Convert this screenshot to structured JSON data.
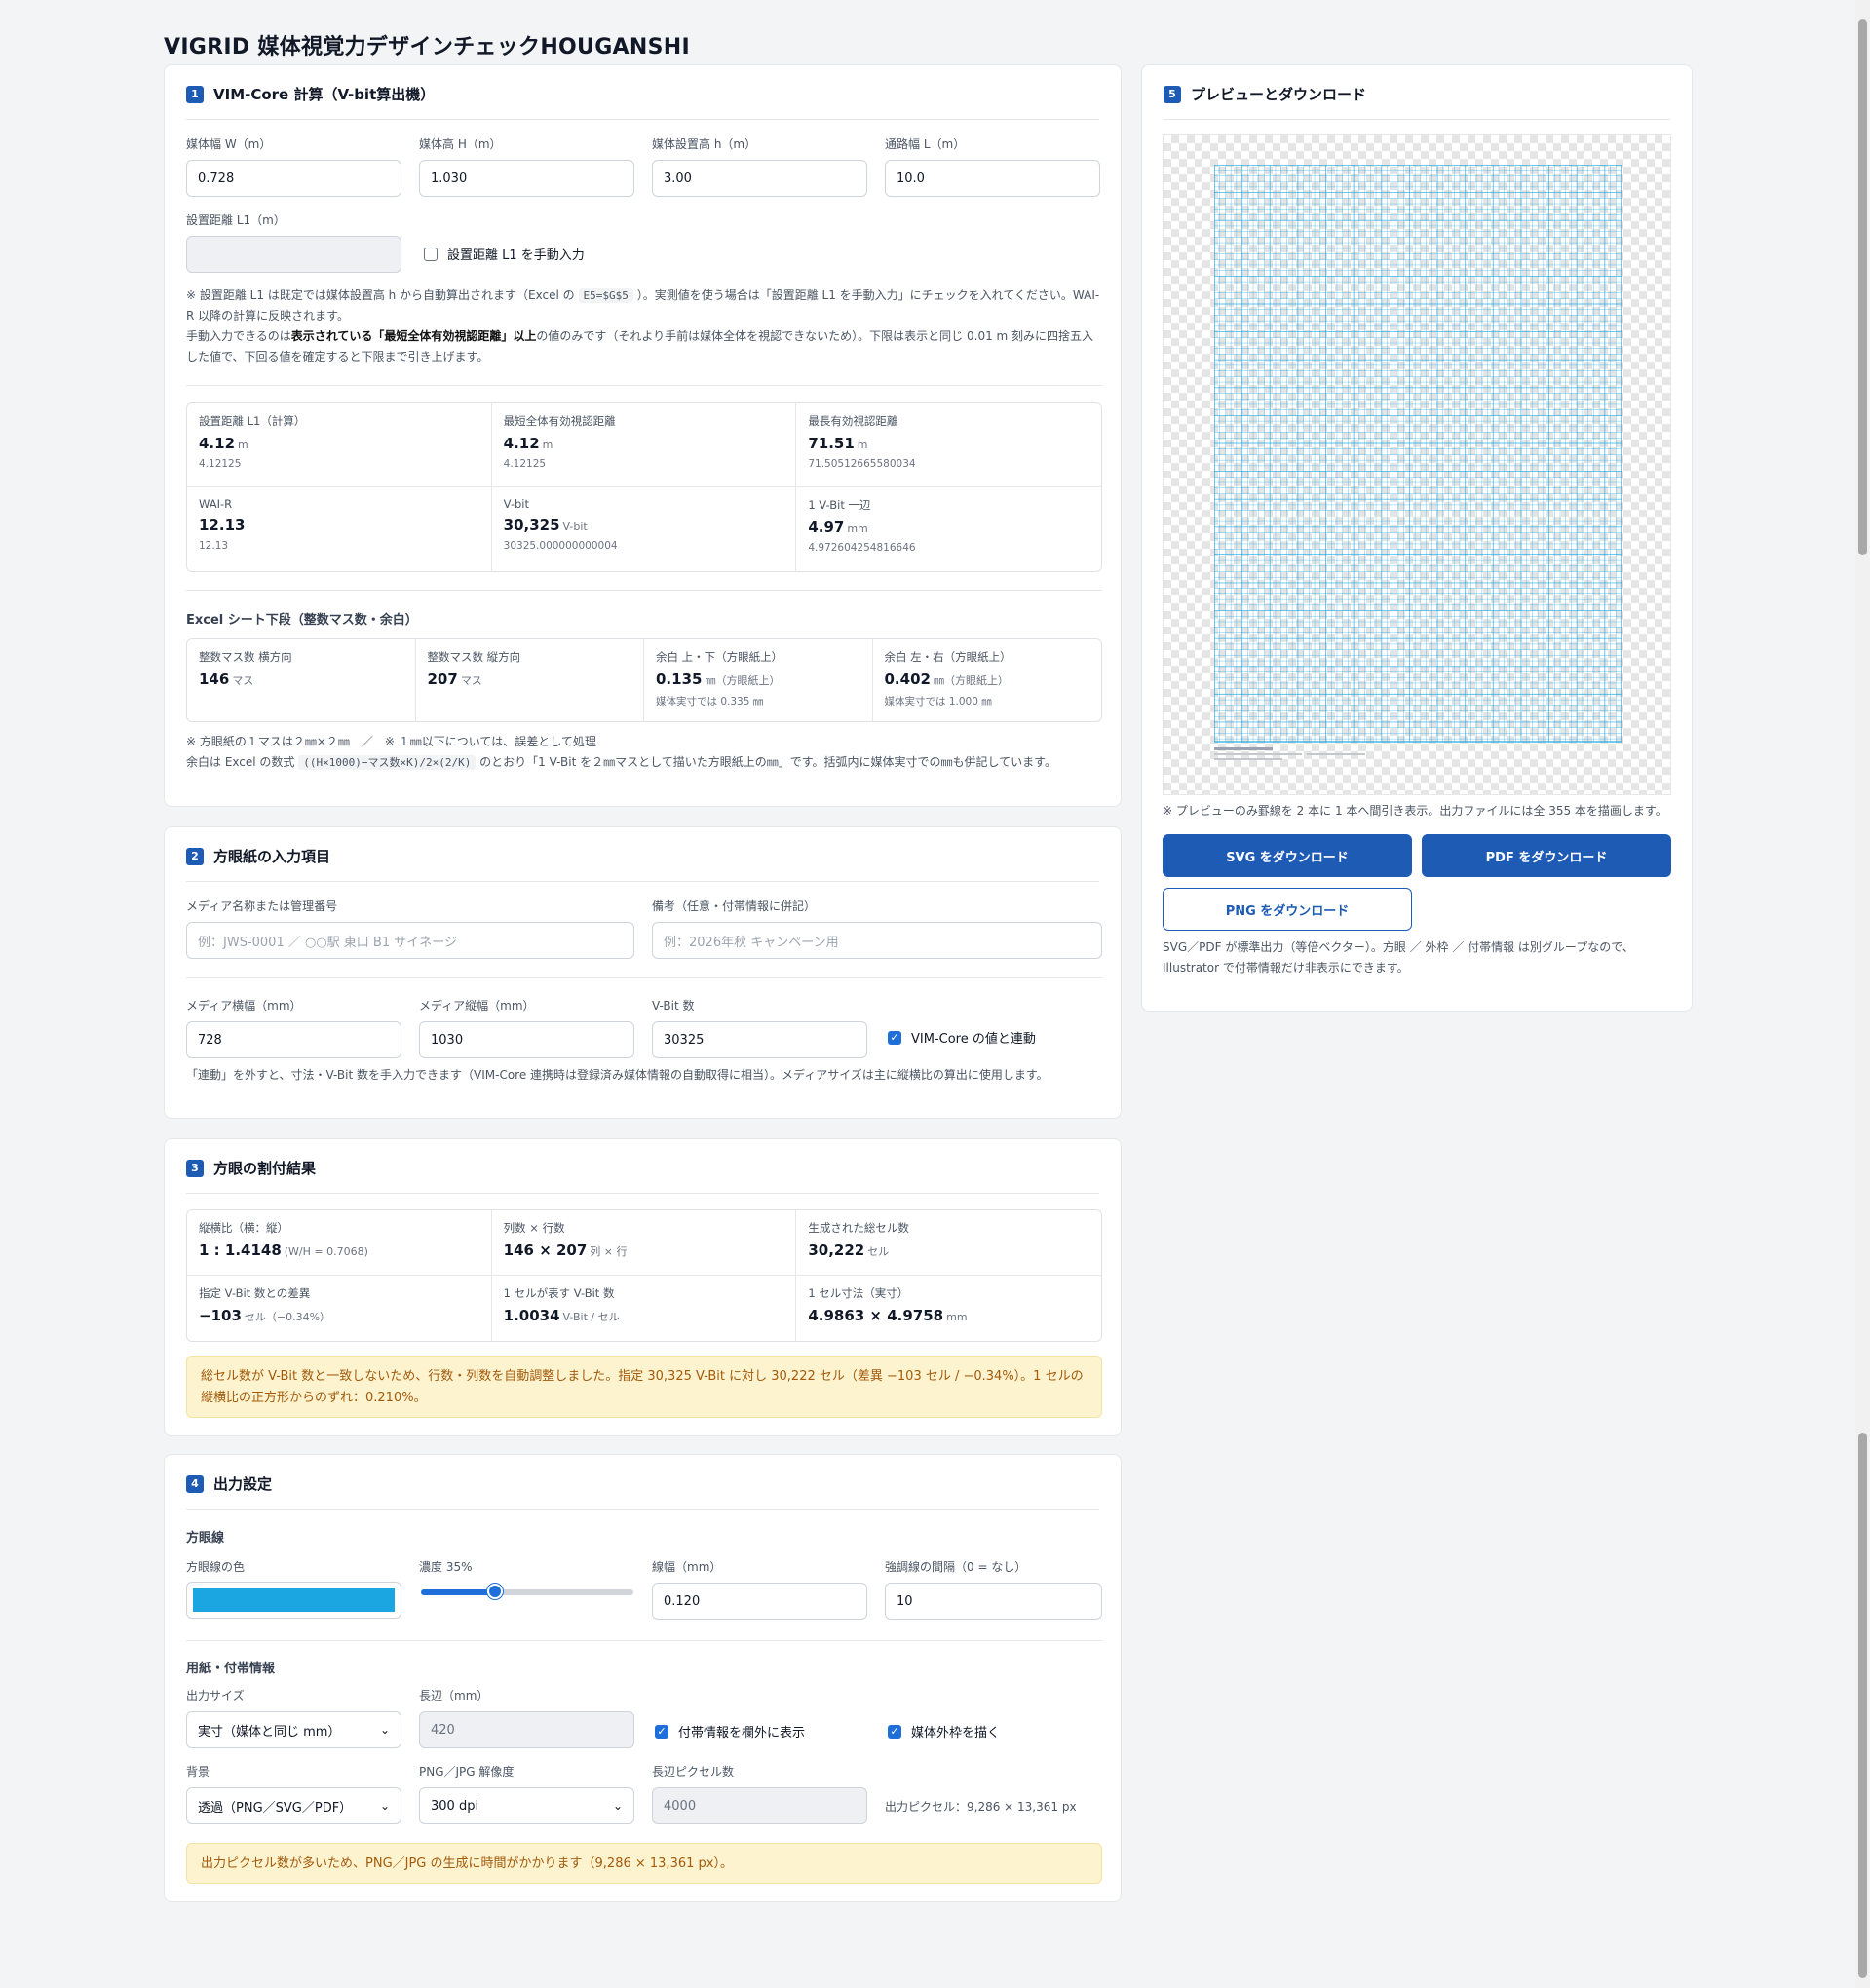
{
  "page": {
    "title": "VIGRID 媒体視覚力デザインチェックHOUGANSHI"
  },
  "s1": {
    "num": "1",
    "title": "VIM-Core 計算（V-bit算出機）",
    "fields": [
      {
        "label": "媒体幅 W（m）",
        "value": "0.728"
      },
      {
        "label": "媒体高 H（m）",
        "value": "1.030"
      },
      {
        "label": "媒体設置高 h（m）",
        "value": "3.00"
      },
      {
        "label": "通路幅 L（m）",
        "value": "10.0"
      }
    ],
    "l1_label": "設置距離 L1（m）",
    "l1_value": "",
    "manual_label": "設置距離 L1 を手動入力",
    "note1a": "※ 設置距離 L1 は既定では媒体設置高 h から自動算出されます（Excel の",
    "note1_code": "E5=$G$5",
    "note1b": "）。実測値を使う場合は「設置距離 L1 を手動入力」にチェックを入れてください。WAI-R 以降の計算に反映されます。",
    "note2a": "手動入力できるのは",
    "note2_bold": "表示されている「最短全体有効視認距離」以上",
    "note2b": "の値のみです（それより手前は媒体全体を視認できないため）。下限は表示と同じ 0.01 m 刻みに四捨五入した値で、下回る値を確定すると下限まで引き上げます。",
    "metrics": [
      {
        "k": "設置距離 L1（計算）",
        "v": "4.12",
        "u": "m",
        "s": "4.12125"
      },
      {
        "k": "最短全体有効視認距離",
        "v": "4.12",
        "u": "m",
        "s": "4.12125"
      },
      {
        "k": "最長有効視認距離",
        "v": "71.51",
        "u": "m",
        "s": "71.50512665580034"
      },
      {
        "k": "WAI-R",
        "v": "12.13",
        "u": "",
        "s": "12.13"
      },
      {
        "k": "V-bit",
        "v": "30,325",
        "u": "V-bit",
        "s": "30325.000000000004"
      },
      {
        "k": "1 V-Bit 一辺",
        "v": "4.97",
        "u": "mm",
        "s": "4.972604254816646"
      }
    ],
    "excel_title": "Excel シート下段（整数マス数・余白）",
    "excel": [
      {
        "k": "整数マス数 横方向",
        "v": "146",
        "u": "マス",
        "s": ""
      },
      {
        "k": "整数マス数 縦方向",
        "v": "207",
        "u": "マス",
        "s": ""
      },
      {
        "k": "余白 上・下（方眼紙上）",
        "v": "0.135",
        "u": "㎜（方眼紙上）",
        "s": "媒体実寸では 0.335 ㎜"
      },
      {
        "k": "余白 左・右（方眼紙上）",
        "v": "0.402",
        "u": "㎜（方眼紙上）",
        "s": "媒体実寸では 1.000 ㎜"
      }
    ],
    "note3": "※ 方眼紙の１マスは２㎜×２㎜　／　※ １㎜以下については、誤差として処理",
    "note4a": "余白は Excel の数式",
    "note4_code": "((H×1000)−マス数×K)/2×(2/K)",
    "note4b": "のとおり「1 V-Bit を２㎜マスとして描いた方眼紙上の㎜」です。括弧内に媒体実寸での㎜も併記しています。"
  },
  "s2": {
    "num": "2",
    "title": "方眼紙の入力項目",
    "media_label": "メディア名称または管理番号",
    "media_placeholder": "例：JWS-0001 ／ ○○駅 東口 B1 サイネージ",
    "memo_label": "備考（任意・付帯情報に併記）",
    "memo_placeholder": "例：2026年秋 キャンペーン用",
    "w_label": "メディア横幅（mm）",
    "w_value": "728",
    "h_label": "メディア縦幅（mm）",
    "h_value": "1030",
    "vb_label": "V-Bit 数",
    "vb_value": "30325",
    "link_label": "VIM-Core の値と連動",
    "note": "「連動」を外すと、寸法・V-Bit 数を手入力できます（VIM-Core 連携時は登録済み媒体情報の自動取得に相当）。メディアサイズは主に縦横比の算出に使用します。"
  },
  "s3": {
    "num": "3",
    "title": "方眼の割付結果",
    "cells": [
      {
        "k": "縦横比（横：縦）",
        "v": "1 : 1.4148",
        "u": "(W/H = 0.7068)"
      },
      {
        "k": "列数 × 行数",
        "v": "146 × 207",
        "u": "列 × 行"
      },
      {
        "k": "生成された総セル数",
        "v": "30,222",
        "u": "セル"
      },
      {
        "k": "指定 V-Bit 数との差異",
        "v": "−103",
        "u": "セル（−0.34%）"
      },
      {
        "k": "1 セルが表す V-Bit 数",
        "v": "1.0034",
        "u": "V-Bit / セル"
      },
      {
        "k": "1 セル寸法（実寸）",
        "v": "4.9863 × 4.9758",
        "u": "mm"
      }
    ],
    "alert": "総セル数が V-Bit 数と一致しないため、行数・列数を自動調整しました。指定 30,325 V-Bit に対し 30,222 セル（差異 −103 セル / −0.34%）。1 セルの縦横比の正方形からのずれ：0.210%。"
  },
  "s4": {
    "num": "4",
    "title": "出力設定",
    "grid_section": "方眼線",
    "color_label": "方眼線の色",
    "color": "#1ba6e2",
    "opacity_label": "濃度 35%",
    "opacity": 0.35,
    "lw_label": "線幅（mm）",
    "lw_value": "0.120",
    "emph_label": "強調線の間隔（0 = なし）",
    "emph_value": "10",
    "paper_section": "用紙・付帯情報",
    "size_label": "出力サイズ",
    "size_value": "実寸（媒体と同じ mm）",
    "long_label": "長辺（mm）",
    "long_value": "420",
    "info_label": "付帯情報を欄外に表示",
    "frame_label": "媒体外枠を描く",
    "bg_label": "背景",
    "bg_value": "透過（PNG／SVG／PDF）",
    "res_label": "PNG／JPG 解像度",
    "res_value": "300 dpi",
    "px_label": "長辺ピクセル数",
    "px_value": "4000",
    "px_out": "出力ピクセル：9,286 × 13,361 px",
    "alert": "出力ピクセル数が多いため、PNG／JPG の生成に時間がかかります（9,286 × 13,361 px）。"
  },
  "s5": {
    "num": "5",
    "title": "プレビューとダウンロード",
    "caption": "※ プレビューのみ罫線を 2 本に 1 本へ間引き表示。出力ファイルには全 355 本を描画します。",
    "svg_btn": "SVG をダウンロード",
    "pdf_btn": "PDF をダウンロード",
    "png_btn": "PNG をダウンロード",
    "note": "SVG／PDF が標準出力（等倍ベクター）。方眼 ／ 外枠 ／ 付帯情報 は別グループなので、Illustrator で付帯情報だけ非表示にできます。",
    "grid_color": "#1ba6e2"
  }
}
